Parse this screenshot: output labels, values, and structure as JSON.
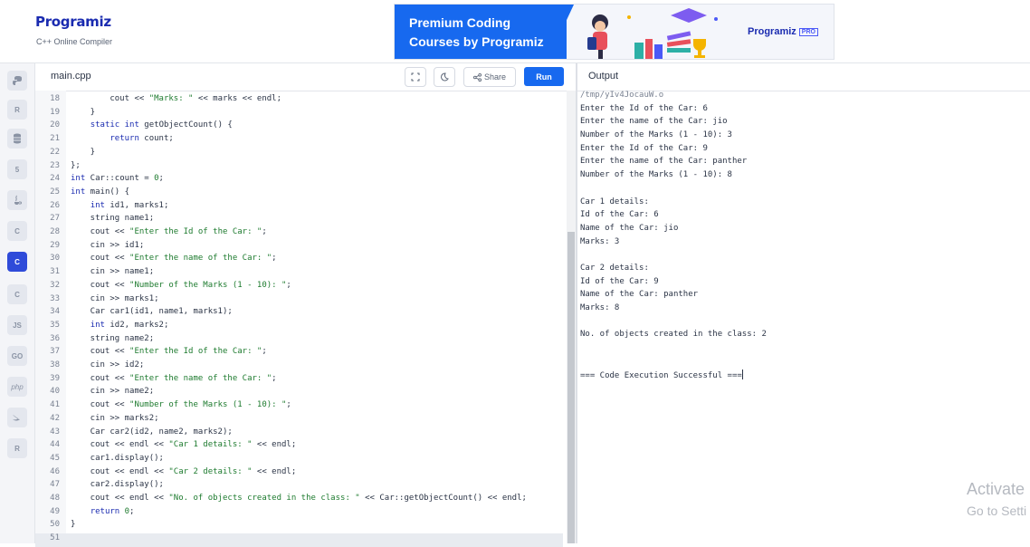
{
  "header": {
    "logo_text": "Programiz",
    "subtitle": "C++ Online Compiler",
    "banner": {
      "line1": "Premium Coding",
      "line2": "Courses by Programiz",
      "brand": "Programiz",
      "badge": "PRO"
    }
  },
  "sidebar": {
    "items": [
      {
        "name": "python",
        "label": ""
      },
      {
        "name": "r",
        "label": "R"
      },
      {
        "name": "sql",
        "label": ""
      },
      {
        "name": "html",
        "label": "5"
      },
      {
        "name": "java",
        "label": ""
      },
      {
        "name": "c",
        "label": "C"
      },
      {
        "name": "cpp",
        "label": "C"
      },
      {
        "name": "csharp",
        "label": "C"
      },
      {
        "name": "javascript",
        "label": "JS"
      },
      {
        "name": "go",
        "label": "GO"
      },
      {
        "name": "php",
        "label": "php"
      },
      {
        "name": "swift",
        "label": ""
      },
      {
        "name": "rust",
        "label": "R"
      }
    ],
    "active_index": 6
  },
  "editor": {
    "file_tab": "main.cpp",
    "share_label": "Share",
    "run_label": "Run",
    "lines": [
      {
        "n": "18",
        "t": "        cout << \"Marks: \" << marks << endl;"
      },
      {
        "n": "19",
        "t": "    }"
      },
      {
        "n": "20",
        "t": "    static int getObjectCount() {"
      },
      {
        "n": "21",
        "t": "        return count;"
      },
      {
        "n": "22",
        "t": "    }"
      },
      {
        "n": "23",
        "t": "};"
      },
      {
        "n": "24",
        "t": "int Car::count = 0;"
      },
      {
        "n": "25",
        "t": "int main() {"
      },
      {
        "n": "26",
        "t": "    int id1, marks1;"
      },
      {
        "n": "27",
        "t": "    string name1;"
      },
      {
        "n": "28",
        "t": "    cout << \"Enter the Id of the Car: \";"
      },
      {
        "n": "29",
        "t": "    cin >> id1;"
      },
      {
        "n": "30",
        "t": "    cout << \"Enter the name of the Car: \";"
      },
      {
        "n": "31",
        "t": "    cin >> name1;"
      },
      {
        "n": "32",
        "t": "    cout << \"Number of the Marks (1 - 10): \";"
      },
      {
        "n": "33",
        "t": "    cin >> marks1;"
      },
      {
        "n": "34",
        "t": "    Car car1(id1, name1, marks1);"
      },
      {
        "n": "35",
        "t": "    int id2, marks2;"
      },
      {
        "n": "36",
        "t": "    string name2;"
      },
      {
        "n": "37",
        "t": "    cout << \"Enter the Id of the Car: \";"
      },
      {
        "n": "38",
        "t": "    cin >> id2;"
      },
      {
        "n": "39",
        "t": "    cout << \"Enter the name of the Car: \";"
      },
      {
        "n": "40",
        "t": "    cin >> name2;"
      },
      {
        "n": "41",
        "t": "    cout << \"Number of the Marks (1 - 10): \";"
      },
      {
        "n": "42",
        "t": "    cin >> marks2;"
      },
      {
        "n": "43",
        "t": "    Car car2(id2, name2, marks2);"
      },
      {
        "n": "44",
        "t": "    cout << endl << \"Car 1 details: \" << endl;"
      },
      {
        "n": "45",
        "t": "    car1.display();"
      },
      {
        "n": "46",
        "t": "    cout << endl << \"Car 2 details: \" << endl;"
      },
      {
        "n": "47",
        "t": "    car2.display();"
      },
      {
        "n": "48",
        "t": "    cout << endl << \"No. of objects created in the class: \" << Car::getObjectCount() << endl;"
      },
      {
        "n": "49",
        "t": "    return 0;"
      },
      {
        "n": "50",
        "t": "}"
      },
      {
        "n": "51",
        "t": ""
      }
    ]
  },
  "output": {
    "label": "Output",
    "lines": [
      "/tmp/yIv4JocauW.o",
      "Enter the Id of the Car: 6",
      "Enter the name of the Car: jio",
      "Number of the Marks (1 - 10): 3",
      "Enter the Id of the Car: 9",
      "Enter the name of the Car: panther",
      "Number of the Marks (1 - 10): 8",
      "",
      "Car 1 details: ",
      "Id of the Car: 6",
      "Name of the Car: jio",
      "Marks: 3",
      "",
      "Car 2 details: ",
      "Id of the Car: 9",
      "Name of the Car: panther",
      "Marks: 8",
      "",
      "No. of objects created in the class: 2",
      "",
      "",
      "=== Code Execution Successful ==="
    ]
  },
  "watermark": {
    "line1": "Activate",
    "line2": "Go to Setti"
  }
}
